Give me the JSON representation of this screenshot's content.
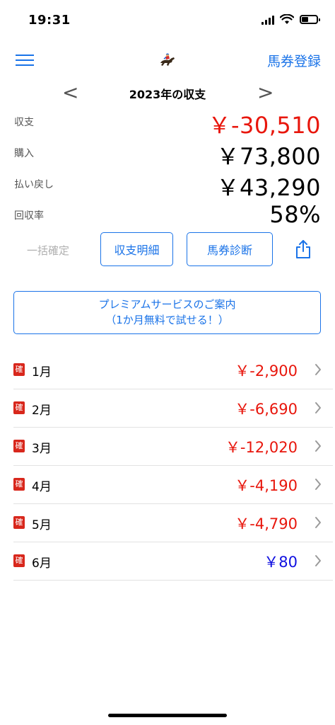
{
  "status_bar": {
    "time": "19:31",
    "battery_level": 0.45
  },
  "nav": {
    "register_label": "馬券登録",
    "logo_icon": "horse-racing-icon",
    "menu_icon": "hamburger-menu-icon"
  },
  "year_selector": {
    "prev": "<",
    "next": ">",
    "title": "2023年の収支"
  },
  "summary": {
    "balance_label": "収支",
    "balance_value": "￥-30,510",
    "purchase_label": "購入",
    "purchase_value": "￥73,800",
    "payout_label": "払い戻し",
    "payout_value": "￥43,290",
    "return_rate_label": "回収率",
    "return_rate_value": "58%"
  },
  "actions": {
    "bulk_confirm": "一括確定",
    "detail_button": "収支明細",
    "diagnosis_button": "馬券診断",
    "share_icon": "share-icon"
  },
  "premium": {
    "line1": "プレミアムサービスのご案内",
    "line2": "（1か月無料で試せる！）"
  },
  "months": [
    {
      "badge": "確",
      "label": "1月",
      "value": "￥-2,900"
    },
    {
      "badge": "確",
      "label": "2月",
      "value": "￥-6,690"
    },
    {
      "badge": "確",
      "label": "3月",
      "value": "￥-12,020"
    },
    {
      "badge": "確",
      "label": "4月",
      "value": "￥-4,190"
    },
    {
      "badge": "確",
      "label": "5月",
      "value": "￥-4,790"
    },
    {
      "badge": "確",
      "label": "6月",
      "value": "￥80"
    }
  ],
  "colors": {
    "accent": "#1a73e8",
    "negative": "#e8160c",
    "positive": "#1010e0",
    "badge": "#d8271c"
  }
}
